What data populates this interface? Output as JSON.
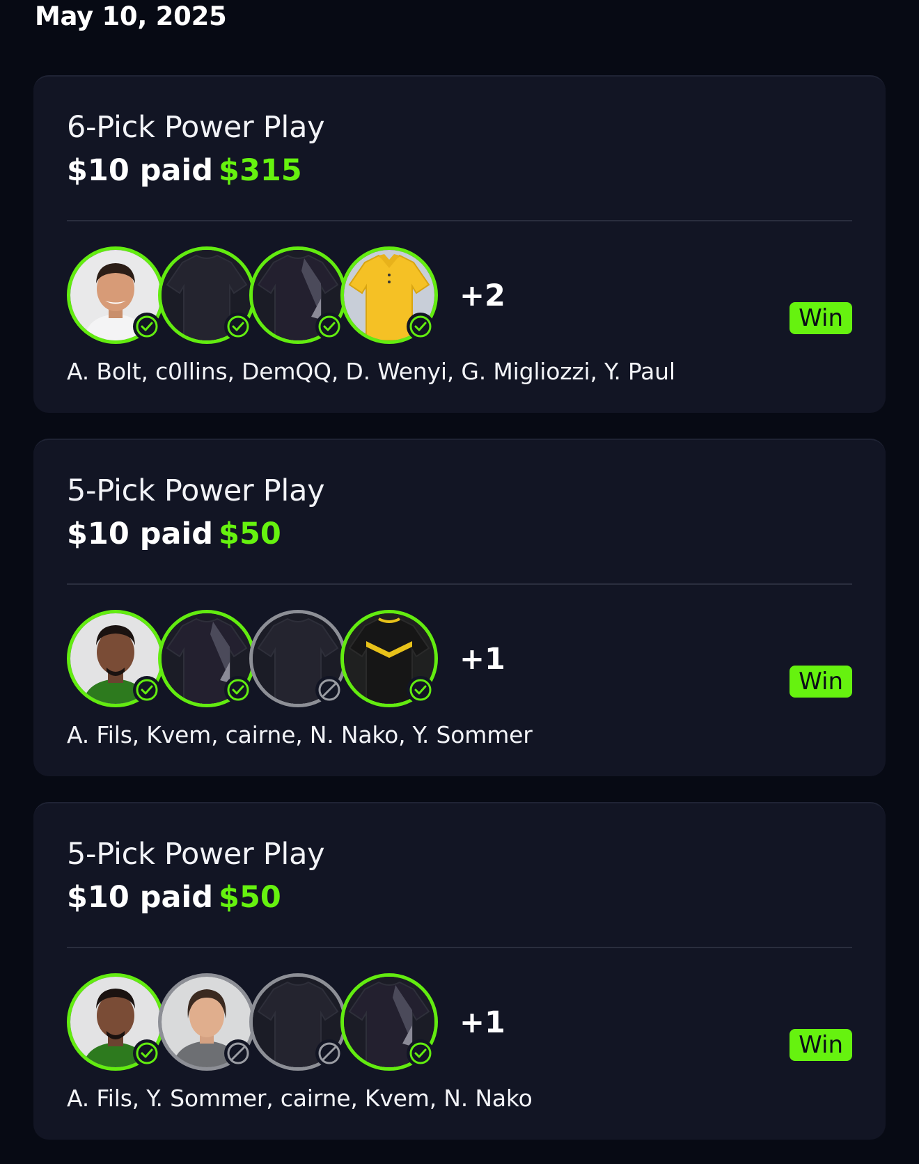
{
  "date": "May 10, 2025",
  "colors": {
    "accent": "#66f20f",
    "card_bg": "#121524",
    "page_bg": "#070a14",
    "pending_ring": "#8d8f96"
  },
  "cards": [
    {
      "title": "6-Pick Power Play",
      "paid": "$10 paid",
      "payout": "$315",
      "more": "+2",
      "result": "Win",
      "players": "A. Bolt, c0llins, DemQQ, D. Wenyi, G. Migliozzi, Y. Paul",
      "avatars": [
        {
          "kind": "face-light",
          "status": "check-icon"
        },
        {
          "kind": "jersey-dark",
          "status": "check-icon"
        },
        {
          "kind": "jersey-dark-stripe",
          "status": "check-icon"
        },
        {
          "kind": "polo-yellow",
          "status": "check-icon"
        }
      ]
    },
    {
      "title": "5-Pick Power Play",
      "paid": "$10 paid",
      "payout": "$50",
      "more": "+1",
      "result": "Win",
      "players": "A. Fils, Kvem, cairne, N. Nako, Y. Sommer",
      "avatars": [
        {
          "kind": "face-dark",
          "status": "check-icon"
        },
        {
          "kind": "jersey-dark-stripe",
          "status": "check-icon"
        },
        {
          "kind": "jersey-dark",
          "status": "void-icon"
        },
        {
          "kind": "jersey-black-yellow",
          "status": "check-icon"
        }
      ]
    },
    {
      "title": "5-Pick Power Play",
      "paid": "$10 paid",
      "payout": "$50",
      "more": "+1",
      "result": "Win",
      "players": "A. Fils, Y. Sommer, cairne, Kvem, N. Nako",
      "avatars": [
        {
          "kind": "face-dark",
          "status": "check-icon"
        },
        {
          "kind": "face-goalkeeper",
          "status": "void-icon"
        },
        {
          "kind": "jersey-dark",
          "status": "void-icon"
        },
        {
          "kind": "jersey-dark-stripe",
          "status": "check-icon"
        }
      ]
    }
  ]
}
